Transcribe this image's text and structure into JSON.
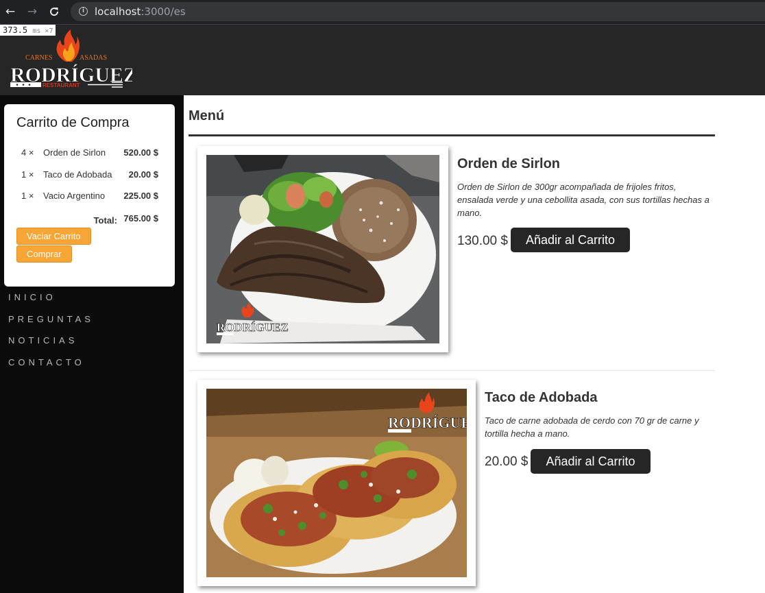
{
  "browser": {
    "back_glyph": "←",
    "forward_glyph": "→",
    "reload_glyph": "C",
    "url_host": "localhost",
    "url_path": ":3000/es"
  },
  "perf_badge": {
    "value": "373.5",
    "unit": "ms ×7"
  },
  "logo": {
    "line1_left": "CARNES",
    "line1_right": "ASADAS",
    "name": "RODRÍGUEZ",
    "sub": "RESTAURANT"
  },
  "cart": {
    "title": "Carrito de Compra",
    "items": [
      {
        "qty": "4 ×",
        "name": "Orden de Sirlon",
        "price": "520.00 $"
      },
      {
        "qty": "1 ×",
        "name": "Taco de Adobada",
        "price": "20.00 $"
      },
      {
        "qty": "1 ×",
        "name": "Vacio Argentino",
        "price": "225.00 $"
      }
    ],
    "total_label": "Total:",
    "total_value": "765.00 $",
    "clear_label": "Vaciar Carrito",
    "buy_label": "Comprar"
  },
  "nav": [
    "INICIO",
    "PREGUNTAS",
    "NOTICIAS",
    "CONTACTO"
  ],
  "menu": {
    "title": "Menú",
    "items": [
      {
        "name": "Orden de Sirlon",
        "description": "Orden de Sirlon de 300gr acompañada de frijoles fritos, ensalada verde y una cebollita asada, con sus tortillas hechas a mano.",
        "price": "130.00 $",
        "button": "Añadir al Carrito"
      },
      {
        "name": "Taco de Adobada",
        "description": "Taco de carne adobada de cerdo con 70 gr de carne y tortilla hecha a mano.",
        "price": "20.00 $",
        "button": "Añadir al Carrito"
      }
    ]
  },
  "colors": {
    "header_bg": "#262626",
    "sidebar_bg": "#0b0b0b",
    "accent_orange": "#f7a534",
    "button_dark": "#262626"
  }
}
